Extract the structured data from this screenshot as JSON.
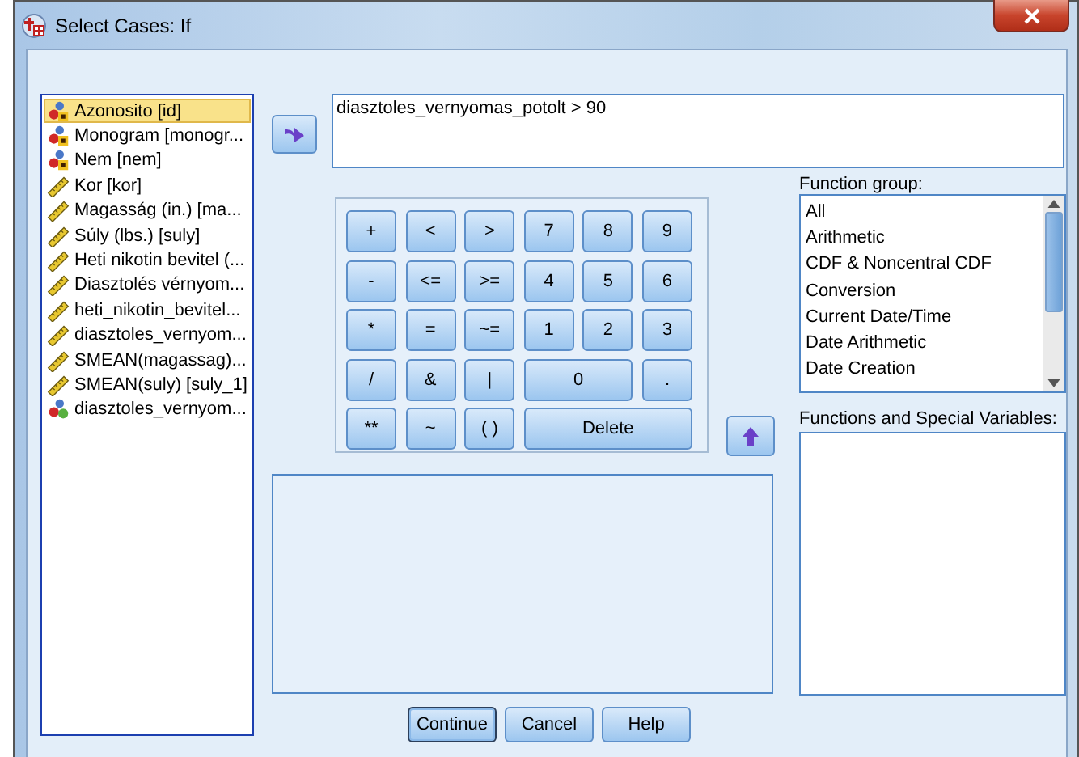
{
  "window": {
    "title": "Select Cases: If"
  },
  "variables": [
    {
      "name": "Azonosito [id]",
      "kind": "string",
      "selected": true
    },
    {
      "name": "Monogram [monogr...",
      "kind": "string",
      "selected": false
    },
    {
      "name": "Nem [nem]",
      "kind": "string",
      "selected": false
    },
    {
      "name": "Kor [kor]",
      "kind": "scale",
      "selected": false
    },
    {
      "name": "Magasság (in.) [ma...",
      "kind": "scale",
      "selected": false
    },
    {
      "name": "Súly (lbs.) [suly]",
      "kind": "scale",
      "selected": false
    },
    {
      "name": "Heti nikotin bevitel (...",
      "kind": "scale",
      "selected": false
    },
    {
      "name": "Diasztolés vérnyom...",
      "kind": "scale",
      "selected": false
    },
    {
      "name": "heti_nikotin_bevitel...",
      "kind": "scale",
      "selected": false
    },
    {
      "name": "diasztoles_vernyom...",
      "kind": "scale",
      "selected": false
    },
    {
      "name": "SMEAN(magassag)...",
      "kind": "scale",
      "selected": false
    },
    {
      "name": "SMEAN(suly) [suly_1]",
      "kind": "scale",
      "selected": false
    },
    {
      "name": "diasztoles_vernyom...",
      "kind": "nominal",
      "selected": false
    }
  ],
  "expression": {
    "value": "diasztoles_vernyomas_potolt > 90"
  },
  "keypad": [
    {
      "label": "+",
      "kind": "key"
    },
    {
      "label": "<",
      "kind": "key"
    },
    {
      "label": ">",
      "kind": "key"
    },
    {
      "label": "7",
      "kind": "key"
    },
    {
      "label": "8",
      "kind": "key"
    },
    {
      "label": "9",
      "kind": "key"
    },
    {
      "label": "-",
      "kind": "key"
    },
    {
      "label": "<=",
      "kind": "key"
    },
    {
      "label": ">=",
      "kind": "key"
    },
    {
      "label": "4",
      "kind": "key"
    },
    {
      "label": "5",
      "kind": "key"
    },
    {
      "label": "6",
      "kind": "key"
    },
    {
      "label": "*",
      "kind": "key"
    },
    {
      "label": "=",
      "kind": "key"
    },
    {
      "label": "~=",
      "kind": "key"
    },
    {
      "label": "1",
      "kind": "key"
    },
    {
      "label": "2",
      "kind": "key"
    },
    {
      "label": "3",
      "kind": "key"
    },
    {
      "label": "/",
      "kind": "key"
    },
    {
      "label": "&",
      "kind": "key"
    },
    {
      "label": "|",
      "kind": "key"
    },
    {
      "label": "0",
      "kind": "wide"
    },
    {
      "label": ".",
      "kind": "key"
    },
    {
      "label": "**",
      "kind": "key"
    },
    {
      "label": "~",
      "kind": "key"
    },
    {
      "label": "( )",
      "kind": "key"
    },
    {
      "label": "Delete",
      "kind": "wider"
    }
  ],
  "function_group": {
    "label": "Function group:",
    "items": [
      {
        "name": "All",
        "selected": false
      },
      {
        "name": "Arithmetic",
        "selected": false
      },
      {
        "name": "CDF & Noncentral CDF",
        "selected": false
      },
      {
        "name": "Conversion",
        "selected": false
      },
      {
        "name": "Current Date/Time",
        "selected": false
      },
      {
        "name": "Date Arithmetic",
        "selected": false
      },
      {
        "name": "Date Creation",
        "selected": false
      }
    ]
  },
  "functions": {
    "label": "Functions and Special Variables:"
  },
  "buttons": [
    {
      "label": "Continue",
      "default": true
    },
    {
      "label": "Cancel",
      "default": false
    },
    {
      "label": "Help",
      "default": false
    }
  ]
}
